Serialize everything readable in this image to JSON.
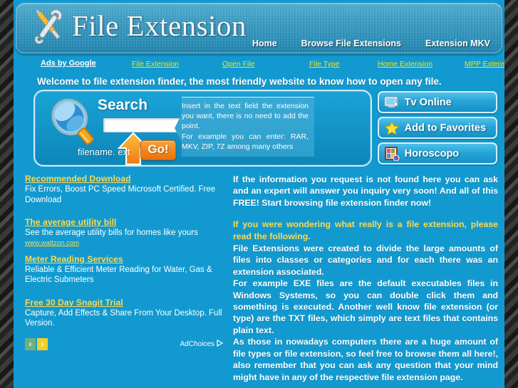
{
  "site": {
    "logo_text": "File Extension",
    "logo_icon": "wrench-screwdriver-icon"
  },
  "nav": {
    "items": [
      {
        "label": "Home"
      },
      {
        "label": "Browse File Extensions"
      },
      {
        "label": "Extension MKV"
      }
    ]
  },
  "ads_strip": {
    "label": "Ads by Google",
    "links": [
      {
        "label": "File Extension"
      },
      {
        "label": "Open File"
      },
      {
        "label": "File Type"
      },
      {
        "label": "Home Extension"
      },
      {
        "label": "MPP Extension"
      }
    ]
  },
  "welcome": "Welcome to file extension finder, the most friendly website to know how to open any file.",
  "search": {
    "label": "Search",
    "value": "",
    "placeholder": "",
    "hint_label": "filename. ext",
    "go_label": "Go!",
    "callout": [
      "Insert in the text field the extension you want, there is no need to add the point.",
      "For example you can enter: RAR, MKV, ZIP, 7Z among many others"
    ]
  },
  "side_buttons": [
    {
      "label": "Tv Online",
      "icon": "tv-monitor-icon"
    },
    {
      "label": "Add to Favorites",
      "icon": "star-icon"
    },
    {
      "label": "Horoscopo",
      "icon": "horoscope-card-icon"
    }
  ],
  "ads": {
    "units": [
      {
        "title": "Recommended Download",
        "desc": "Fix Errors, Boost PC Speed Microsoft Certified. Free Download",
        "url": ""
      },
      {
        "title": "The average utility bill",
        "desc": "See the average utility bills for homes like yours",
        "url": "www.wattzon.com"
      },
      {
        "title": "Meter Reading Services",
        "desc": "Reliable & Efficient Meter Reading for Water, Gas & Electric Submeters",
        "url": ""
      },
      {
        "title": "Free 30 Day Snagit Trial",
        "desc": "Capture, Add Effects & Share From Your Desktop. Full Version.",
        "url": ""
      }
    ],
    "prev_label": "‹",
    "next_label": "›",
    "adchoices_label": "AdChoices"
  },
  "content": {
    "intro": "If the information you request is not found here you can ask and an expert will answer you inquiry very soon! And all of this FREE! Start browsing file extension finder now!",
    "heading": "If you were wondering what really is a file extension, please read the following.",
    "paragraphs": [
      "File Extensions were created to divide the large amounts of files into classes or categories and for each there was an extension associated.",
      "For example EXE files are the default executables files in Windows Systems, so you can double click them and something is executed. Another well know file extension (or type) are the TXT files, which simply are text files that contains plain text.",
      "As those in nowadays computers there are a huge amount of file types or file extension, so feel free to browse them all here!, also remember that you can ask any question that your mind might have in any of the respective file extension page."
    ]
  },
  "colors": {
    "page_blue": "#129ad0",
    "accent_yellow": "#ffd84d",
    "go_orange": "#f4851c",
    "header_blue": "#3c9fc6"
  }
}
